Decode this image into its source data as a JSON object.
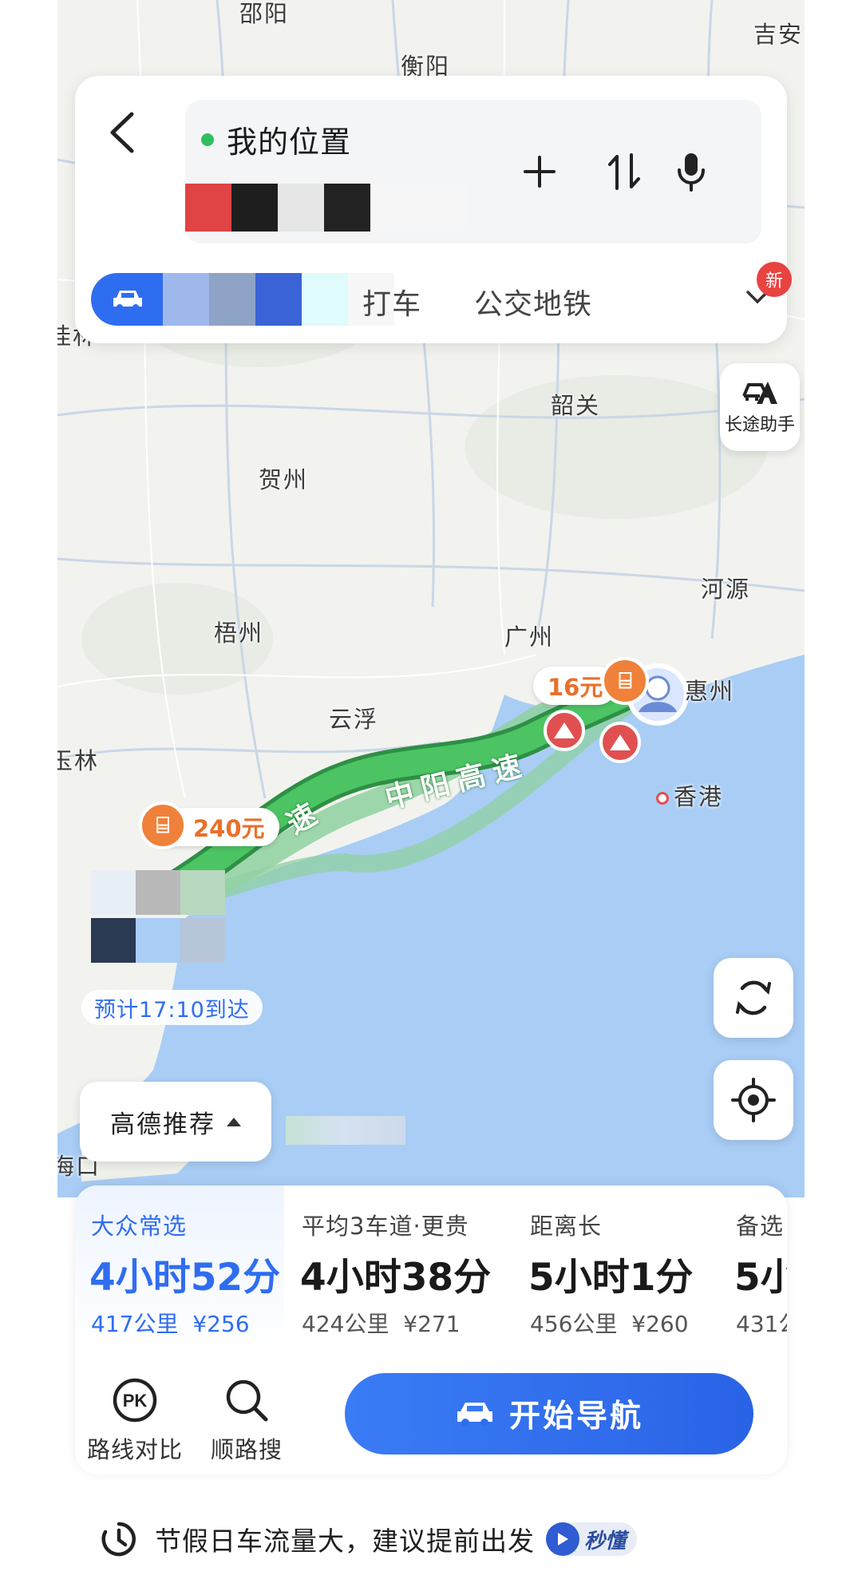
{
  "search": {
    "origin": "我的位置",
    "modes": [
      {
        "label": "打车"
      },
      {
        "label": "公交地铁"
      }
    ],
    "new_badge": "新"
  },
  "map": {
    "cities": [
      "邵阳",
      "衡阳",
      "吉安",
      "桂林",
      "韶关",
      "贺州",
      "河源",
      "梧州",
      "广州",
      "惠州",
      "云浮",
      "玉林",
      "香港",
      "海口"
    ],
    "toll_near": "16元",
    "toll_far": "240元",
    "road_name": "中阳高速",
    "road_name_left": "速",
    "eta": "预计17:10到达",
    "long_trip_label": "长途助手",
    "recommend_label": "高德推荐"
  },
  "routes": [
    {
      "label": "大众常选",
      "time": "4小时52分",
      "distance": "417公里",
      "cost": "¥256",
      "selected": true
    },
    {
      "label": "平均3车道·更贵",
      "time": "4小时38分",
      "distance": "424公里",
      "cost": "¥271",
      "selected": false
    },
    {
      "label": "距离长",
      "time": "5小时1分",
      "distance": "456公里",
      "cost": "¥260",
      "selected": false
    },
    {
      "label": "备选",
      "time": "5小",
      "distance": "431公",
      "cost": "",
      "selected": false
    }
  ],
  "tools": {
    "compare_label": "路线对比",
    "compare_icon_text": "PK",
    "search_along_label": "顺路搜"
  },
  "nav": {
    "start_label": "开始导航"
  },
  "tip": {
    "text": "节假日车流量大，建议提前出发",
    "miao_label": "秒懂"
  },
  "colors": {
    "accent": "#2f6df0",
    "route_green": "#3cab55",
    "sea": "#a9cdf5",
    "toll_orange": "#f0813a"
  }
}
